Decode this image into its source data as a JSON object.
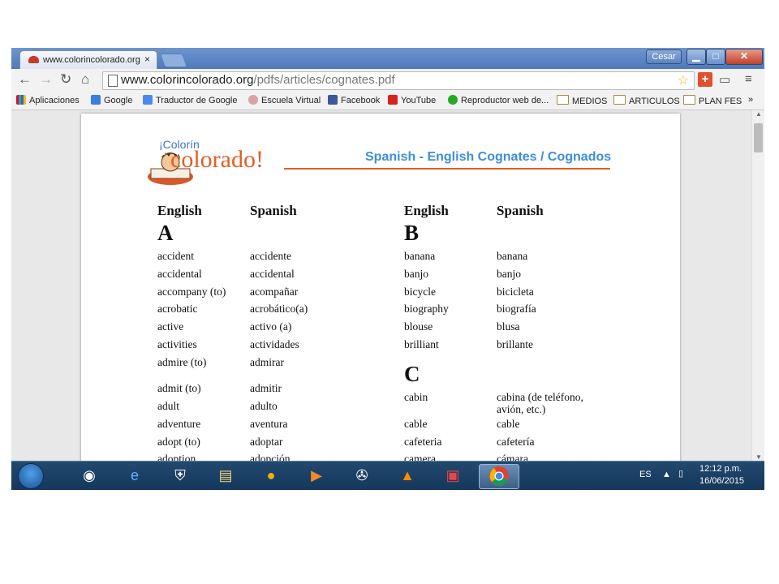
{
  "browser": {
    "tab_title": "www.colorincolorado.org",
    "tab_close": "×",
    "user_button": "Cesar",
    "window_controls": {
      "minimize": "▁",
      "maximize": "□",
      "close": "✕"
    },
    "url_host": "www.colorincolorado.org",
    "url_path": "/pdfs/articles/cognates.pdf",
    "bookmarks": [
      "Aplicaciones",
      "Google",
      "Traductor de Google",
      "Escuela Virtual",
      "Facebook",
      "YouTube",
      "Reproductor web de...",
      "MEDIOS",
      "ARTICULOS",
      "PLAN FES"
    ],
    "bookmarks_more": "»"
  },
  "pdf": {
    "logo_top": "¡Colorín",
    "logo_main": "colorado!",
    "title": "Spanish - English Cognates / Cognados",
    "col_header_english": "English",
    "col_header_spanish": "Spanish",
    "left": {
      "letter": "A",
      "words": [
        {
          "en": "accident",
          "es": "accidente"
        },
        {
          "en": "accidental",
          "es": "accidental"
        },
        {
          "en": "accompany (to)",
          "es": "acompañar"
        },
        {
          "en": "acrobatic",
          "es": "acrobático(a)"
        },
        {
          "en": "active",
          "es": "activo (a)"
        },
        {
          "en": "activities",
          "es": "actividades"
        },
        {
          "en": "admire (to)",
          "es": "admirar"
        },
        {
          "en": "admit (to)",
          "es": "admitir"
        },
        {
          "en": "adult",
          "es": "adulto"
        },
        {
          "en": "adventure",
          "es": "aventura"
        },
        {
          "en": "adopt (to)",
          "es": "adoptar"
        },
        {
          "en": "adoption",
          "es": "adopción"
        }
      ]
    },
    "right_b": {
      "letter": "B",
      "words": [
        {
          "en": "banana",
          "es": "banana"
        },
        {
          "en": "banjo",
          "es": "banjo"
        },
        {
          "en": "bicycle",
          "es": "bicicleta"
        },
        {
          "en": "biography",
          "es": "biografía"
        },
        {
          "en": "blouse",
          "es": "blusa"
        },
        {
          "en": "brilliant",
          "es": "brillante"
        }
      ]
    },
    "right_c": {
      "letter": "C",
      "words": [
        {
          "en": "cabin",
          "es": "cabina (de teléfono,",
          "es2": "avión, etc.)"
        },
        {
          "en": "cable",
          "es": "cable"
        },
        {
          "en": "cafeteria",
          "es": "cafetería"
        },
        {
          "en": "camera",
          "es": "cámara"
        }
      ]
    }
  },
  "taskbar": {
    "language": "ES",
    "time": "12:12 p.m.",
    "date": "16/06/2015"
  }
}
